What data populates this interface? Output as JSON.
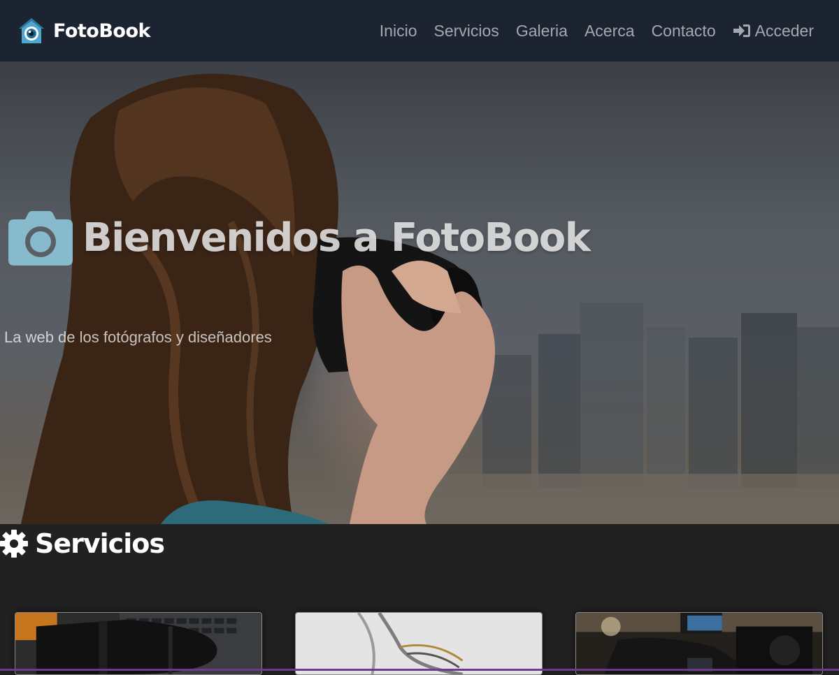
{
  "navbar": {
    "brand": "FotoBook",
    "brand_icon": "eye-house-logo-icon",
    "links": [
      {
        "label": "Inicio"
      },
      {
        "label": "Servicios"
      },
      {
        "label": "Galeria"
      },
      {
        "label": "Acerca"
      },
      {
        "label": "Contacto"
      }
    ],
    "login": {
      "label": "Acceder",
      "icon": "sign-in-icon"
    }
  },
  "hero": {
    "icon": "camera-icon",
    "title": "Bienvenidos a FotoBook",
    "subtitle": "La web de los fotógrafos y diseñadores"
  },
  "services": {
    "icon": "gear-icon",
    "title": "Servicios",
    "cards": [
      {
        "image": "camera-lens-on-laptop-photo"
      },
      {
        "image": "eyelash-curler-photo"
      },
      {
        "image": "video-camera-rig-photo"
      }
    ]
  },
  "colors": {
    "navbar_bg": "#1c2331",
    "page_bg": "#212121",
    "accent_icon": "#8cc4d8",
    "nav_text": "rgba(255,255,255,0.6)"
  }
}
